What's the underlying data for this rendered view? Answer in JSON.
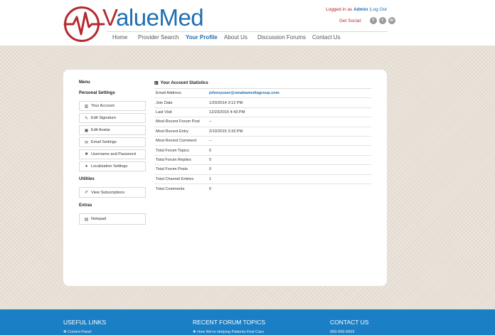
{
  "brand": {
    "name_v": "V",
    "name_rest": "alueMed"
  },
  "account": {
    "logged_in_prefix": "Logged in as",
    "username": "Admin",
    "separator": "|",
    "logout": "Log Out"
  },
  "social": {
    "label": "Get Social:",
    "icons": [
      "facebook-icon",
      "twitter-icon",
      "linkedin-icon"
    ],
    "glyphs": [
      "f",
      "t",
      "in"
    ]
  },
  "nav": {
    "items": [
      "Home",
      "Provider Search",
      "Your Profile",
      "About Us",
      "Discussion Forums",
      "Contact Us"
    ],
    "active": "Your Profile"
  },
  "sidebar": {
    "menu_title": "Menu",
    "sections": [
      {
        "title": "Personal Settings",
        "items": [
          {
            "label": "Your Account",
            "icon": "bar-chart-icon"
          },
          {
            "label": "Edit Signature",
            "icon": "pencil-icon"
          },
          {
            "label": "Edit Avatar",
            "icon": "image-icon"
          },
          {
            "label": "Email Settings",
            "icon": "envelope-icon"
          },
          {
            "label": "Username and Password",
            "icon": "lock-icon"
          },
          {
            "label": "Localization Settings",
            "icon": "globe-icon"
          }
        ]
      },
      {
        "title": "Utilities",
        "items": [
          {
            "label": "View Subscriptions",
            "icon": "edit-icon"
          }
        ]
      },
      {
        "title": "Extras",
        "items": [
          {
            "label": "Notepad",
            "icon": "document-icon"
          }
        ]
      }
    ]
  },
  "stats": {
    "title": "Your Account Statistics",
    "rows": [
      {
        "label": "Email Address",
        "value": "johnnyuser@omahamediagroup.com"
      },
      {
        "label": "Join Date",
        "value": "1/20/2014 3:12 PM"
      },
      {
        "label": "Last Visit",
        "value": "12/23/2015 4:43 PM"
      },
      {
        "label": "Most Recent Forum Post",
        "value": "--"
      },
      {
        "label": "Most Recent Entry",
        "value": "2/10/2015 3:33 PM"
      },
      {
        "label": "Most Recent Comment",
        "value": "--"
      },
      {
        "label": "Total Forum Topics",
        "value": "0"
      },
      {
        "label": "Total Forum Replies",
        "value": "0"
      },
      {
        "label": "Total Forum Posts",
        "value": "0"
      },
      {
        "label": "Total Channel Entries",
        "value": "1"
      },
      {
        "label": "Total Comments",
        "value": "0"
      }
    ]
  },
  "footer": {
    "columns": [
      {
        "title": "USEFUL LINKS",
        "first_item": "Control Panel"
      },
      {
        "title": "RECENT FORUM TOPICS",
        "first_item": "How We're Helping Patients Find Care"
      },
      {
        "title": "CONTACT US",
        "first_item": "999-999-9999"
      }
    ]
  },
  "colors": {
    "brand_blue": "#1f6fb2",
    "brand_red": "#b5292f",
    "footer_blue": "#1b7fc5"
  }
}
